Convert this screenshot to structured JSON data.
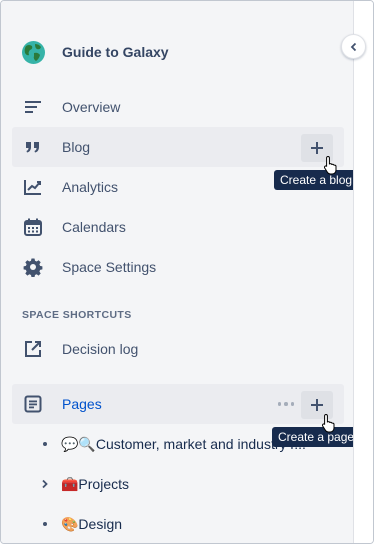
{
  "space": {
    "title": "Guide to Galaxy",
    "logo": "globe-icon"
  },
  "nav": [
    {
      "key": "overview",
      "label": "Overview",
      "icon": "overview-lines-icon"
    },
    {
      "key": "blog",
      "label": "Blog",
      "icon": "quote-icon",
      "action": "Create a blog"
    },
    {
      "key": "analytics",
      "label": "Analytics",
      "icon": "chart-line-icon"
    },
    {
      "key": "calendars",
      "label": "Calendars",
      "icon": "calendar-icon"
    },
    {
      "key": "space-settings",
      "label": "Space Settings",
      "icon": "gear-icon"
    }
  ],
  "shortcuts": {
    "header": "SPACE SHORTCUTS",
    "items": [
      {
        "label": "Decision log",
        "icon": "external-link-icon"
      }
    ]
  },
  "pages": {
    "label": "Pages",
    "icon": "page-icon",
    "action": "Create a page",
    "tree": [
      {
        "label": "💬🔍Customer, market and industry r...",
        "toggle": "bullet"
      },
      {
        "label": "🧰Projects",
        "toggle": "chevron"
      },
      {
        "label": "🎨Design",
        "toggle": "bullet"
      }
    ]
  },
  "tooltips": {
    "blog": "Create a blog",
    "pages": "Create a page"
  },
  "colors": {
    "sidebar_bg": "#f4f5f7",
    "active_bg": "#ebecf0",
    "link": "#0052cc",
    "text": "#42526e",
    "tooltip_bg": "#172b4d"
  }
}
